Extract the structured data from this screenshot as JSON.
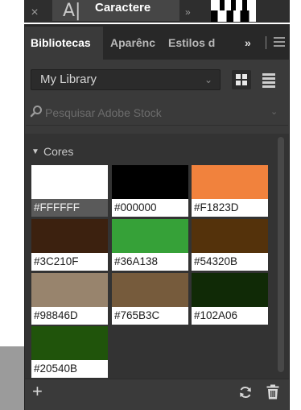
{
  "topbar": {
    "close_glyph": "×",
    "tab_icon_glyph": "A|",
    "tab_label": "Caractere",
    "more_glyph": "»"
  },
  "tabs": [
    {
      "label": "Bibliotecas",
      "active": true
    },
    {
      "label": "Aparênc",
      "active": false
    },
    {
      "label": "Estilos d",
      "active": false
    }
  ],
  "tabs_more_glyph": "»",
  "library_select": {
    "value": "My Library"
  },
  "search": {
    "placeholder": "Pesquisar Adobe Stock"
  },
  "section": {
    "title": "Cores",
    "expanded": true
  },
  "swatches": [
    {
      "hex": "#FFFFFF",
      "color": "#FFFFFF",
      "selected": true
    },
    {
      "hex": "#000000",
      "color": "#000000",
      "selected": false
    },
    {
      "hex": "#F1823D",
      "color": "#F1823D",
      "selected": false
    },
    {
      "hex": "#3C210F",
      "color": "#3C210F",
      "selected": false
    },
    {
      "hex": "#36A138",
      "color": "#36A138",
      "selected": false
    },
    {
      "hex": "#54320B",
      "color": "#54320B",
      "selected": false
    },
    {
      "hex": "#98846D",
      "color": "#98846D",
      "selected": false
    },
    {
      "hex": "#765B3C",
      "color": "#765B3C",
      "selected": false
    },
    {
      "hex": "#102A06",
      "color": "#102A06",
      "selected": false
    },
    {
      "hex": "#20540B",
      "color": "#20540B",
      "selected": false
    }
  ],
  "bottom": {
    "add_glyph": "+"
  },
  "icons": {
    "close": "close-icon",
    "character": "character-icon",
    "menu": "hamburger-icon",
    "grid": "grid-view-icon",
    "list": "list-view-icon",
    "search": "search-icon",
    "sync": "sync-icon",
    "trash": "trash-icon"
  }
}
